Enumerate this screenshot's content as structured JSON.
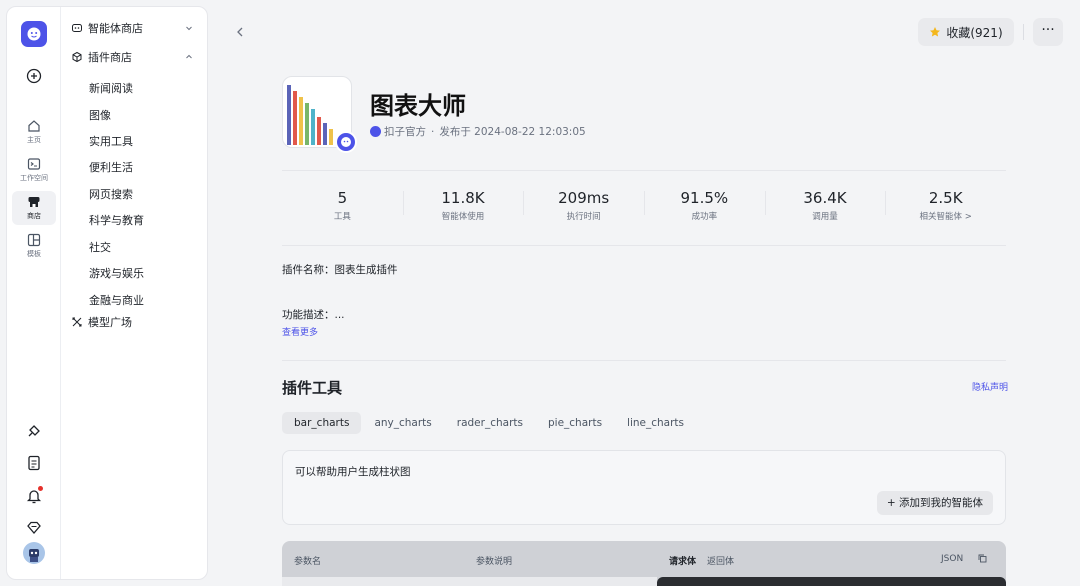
{
  "rail": {
    "items": [
      {
        "label": "主页",
        "icon": "home-icon"
      },
      {
        "label": "工作空间",
        "icon": "terminal-icon"
      },
      {
        "label": "商店",
        "icon": "store-icon"
      },
      {
        "label": "模板",
        "icon": "template-icon"
      }
    ]
  },
  "sidebar": {
    "agent_store": "智能体商店",
    "plugin_store": "插件商店",
    "categories": [
      "新闻阅读",
      "图像",
      "实用工具",
      "便利生活",
      "网页搜索",
      "科学与教育",
      "社交",
      "游戏与娱乐",
      "金融与商业"
    ],
    "model_square": "模型广场"
  },
  "header": {
    "favorite_label": "收藏(921)",
    "more_label": "···"
  },
  "plugin": {
    "title": "图表大师",
    "author": "扣子官方",
    "published": "发布于 2024-08-22 12:03:05",
    "name_line": "插件名称：图表生成插件",
    "desc_line": "功能描述：...",
    "see_more": "查看更多"
  },
  "stats": [
    {
      "value": "5",
      "label": "工具"
    },
    {
      "value": "11.8K",
      "label": "智能体使用"
    },
    {
      "value": "209ms",
      "label": "执行时间"
    },
    {
      "value": "91.5%",
      "label": "成功率"
    },
    {
      "value": "36.4K",
      "label": "调用量"
    },
    {
      "value": "2.5K",
      "label": "相关智能体 >"
    }
  ],
  "tools": {
    "heading": "插件工具",
    "privacy": "隐私声明",
    "tabs": [
      "bar_charts",
      "any_charts",
      "rader_charts",
      "pie_charts",
      "line_charts"
    ],
    "active_desc": "可以帮助用户生成柱状图",
    "add_label": "添加到我的智能体"
  },
  "params": {
    "col_name": "参数名",
    "col_desc": "参数说明",
    "tab_request": "请求体",
    "tab_response": "返回体",
    "format": "JSON"
  },
  "colors": {
    "accent": "#4d53e8",
    "notification": "#e5312b"
  }
}
